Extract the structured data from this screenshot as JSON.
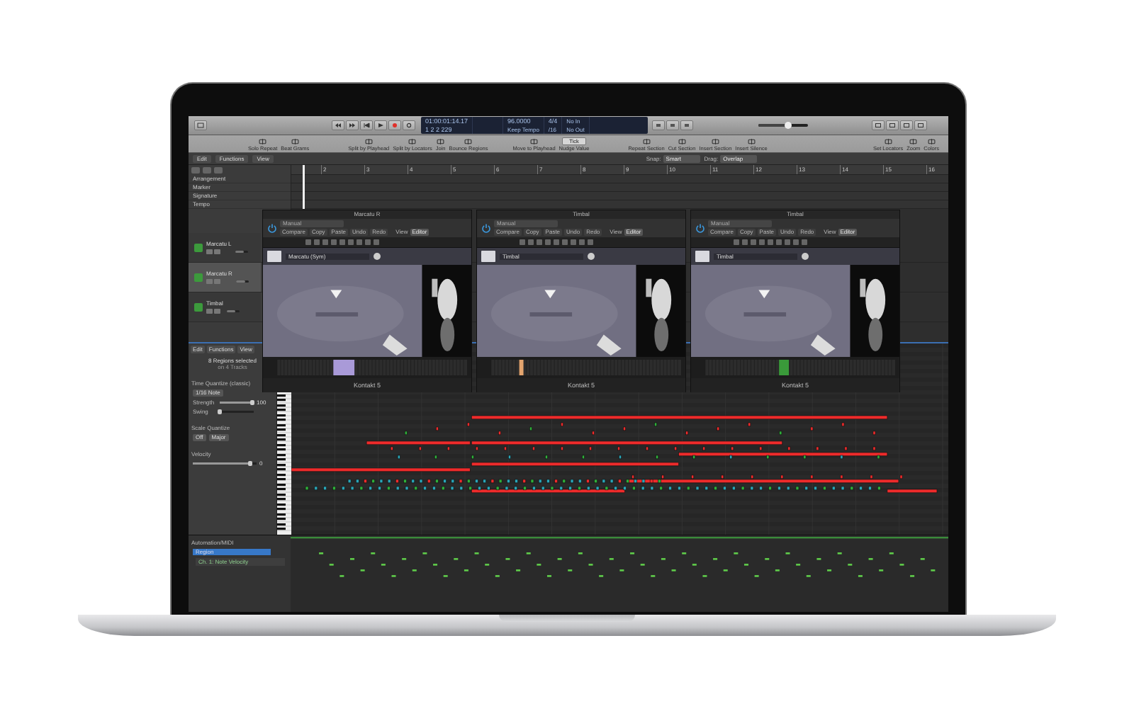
{
  "control_bar": {
    "lcd_time": "01:00:01:14.17",
    "lcd_position": "1  2  2  229",
    "tempo": "96.0000",
    "tempo_mode": "Keep Tempo",
    "signature": "4/4",
    "division": "/16",
    "input": "No In",
    "output": "No Out",
    "record_enabled": true,
    "master_volume": {
      "level": 0.6
    }
  },
  "toolbar": {
    "groups": [
      [
        "Solo Repeat",
        "Beat Grams"
      ],
      [
        "Split by Playhead",
        "Split by Locators",
        "Join",
        "Bounce Regions"
      ],
      [
        "Move to Playhead"
      ],
      [
        "Repeat Section",
        "Cut Section",
        "Insert Section",
        "Insert Silence"
      ],
      [
        "Set Locators",
        "Zoom",
        "Colors"
      ]
    ],
    "nudge_label": "Nudge Value",
    "nudge_value": "Tick"
  },
  "menu_bar": {
    "items": [
      "Edit",
      "Functions",
      "View"
    ],
    "snap_label": "Snap:",
    "snap": "Smart",
    "drag_label": "Drag:",
    "drag": "Overlap"
  },
  "ruler": [
    "2",
    "3",
    "4",
    "5",
    "6",
    "7",
    "8",
    "9",
    "10",
    "11",
    "12",
    "13",
    "14",
    "15",
    "16"
  ],
  "global_tracks": [
    "Arrangement",
    "Marker",
    "Signature",
    "Tempo"
  ],
  "tracks": [
    {
      "name": "Marcatu L",
      "selected": false,
      "level": 0.7
    },
    {
      "name": "Marcatu R",
      "selected": true,
      "level": 0.7
    },
    {
      "name": "Timbal",
      "selected": false,
      "level": 0.7
    }
  ],
  "plugins": [
    {
      "title": "Marcatu R",
      "preset": "Manual",
      "buttons": [
        "Compare",
        "Copy",
        "Paste",
        "Undo",
        "Redo"
      ],
      "view": "View",
      "editor": "Editor",
      "instrument": "Marcatu (Sym)",
      "footer": "Kontakt 5"
    },
    {
      "title": "Timbal",
      "preset": "Manual",
      "buttons": [
        "Compare",
        "Copy",
        "Paste",
        "Undo",
        "Redo"
      ],
      "view": "View",
      "editor": "Editor",
      "instrument": "Timbal",
      "footer": "Kontakt 5"
    },
    {
      "title": "Timbal",
      "preset": "Manual",
      "buttons": [
        "Compare",
        "Copy",
        "Paste",
        "Undo",
        "Redo"
      ],
      "view": "View",
      "editor": "Editor",
      "instrument": "Timbal",
      "footer": "Kontakt 5"
    }
  ],
  "editor": {
    "menu": [
      "Edit",
      "Functions",
      "View"
    ],
    "selection": "8 Regions selected",
    "selection_detail": "on 4 Tracks"
  },
  "inspector": {
    "time_quantize_label": "Time Quantize (classic)",
    "time_quantize": "1/16 Note",
    "strength": {
      "label": "Strength",
      "value": "100",
      "level": 0.95
    },
    "swing": {
      "label": "Swing",
      "level": 0
    },
    "scale_quantize_label": "Scale Quantize",
    "scale_root": "Off",
    "scale_type": "Major",
    "velocity": {
      "label": "Velocity",
      "value": "0",
      "level": 0.9
    }
  },
  "automation": {
    "label": "Automation/MIDI",
    "region": "Region",
    "parameter": "Ch. 1: Note Velocity"
  }
}
